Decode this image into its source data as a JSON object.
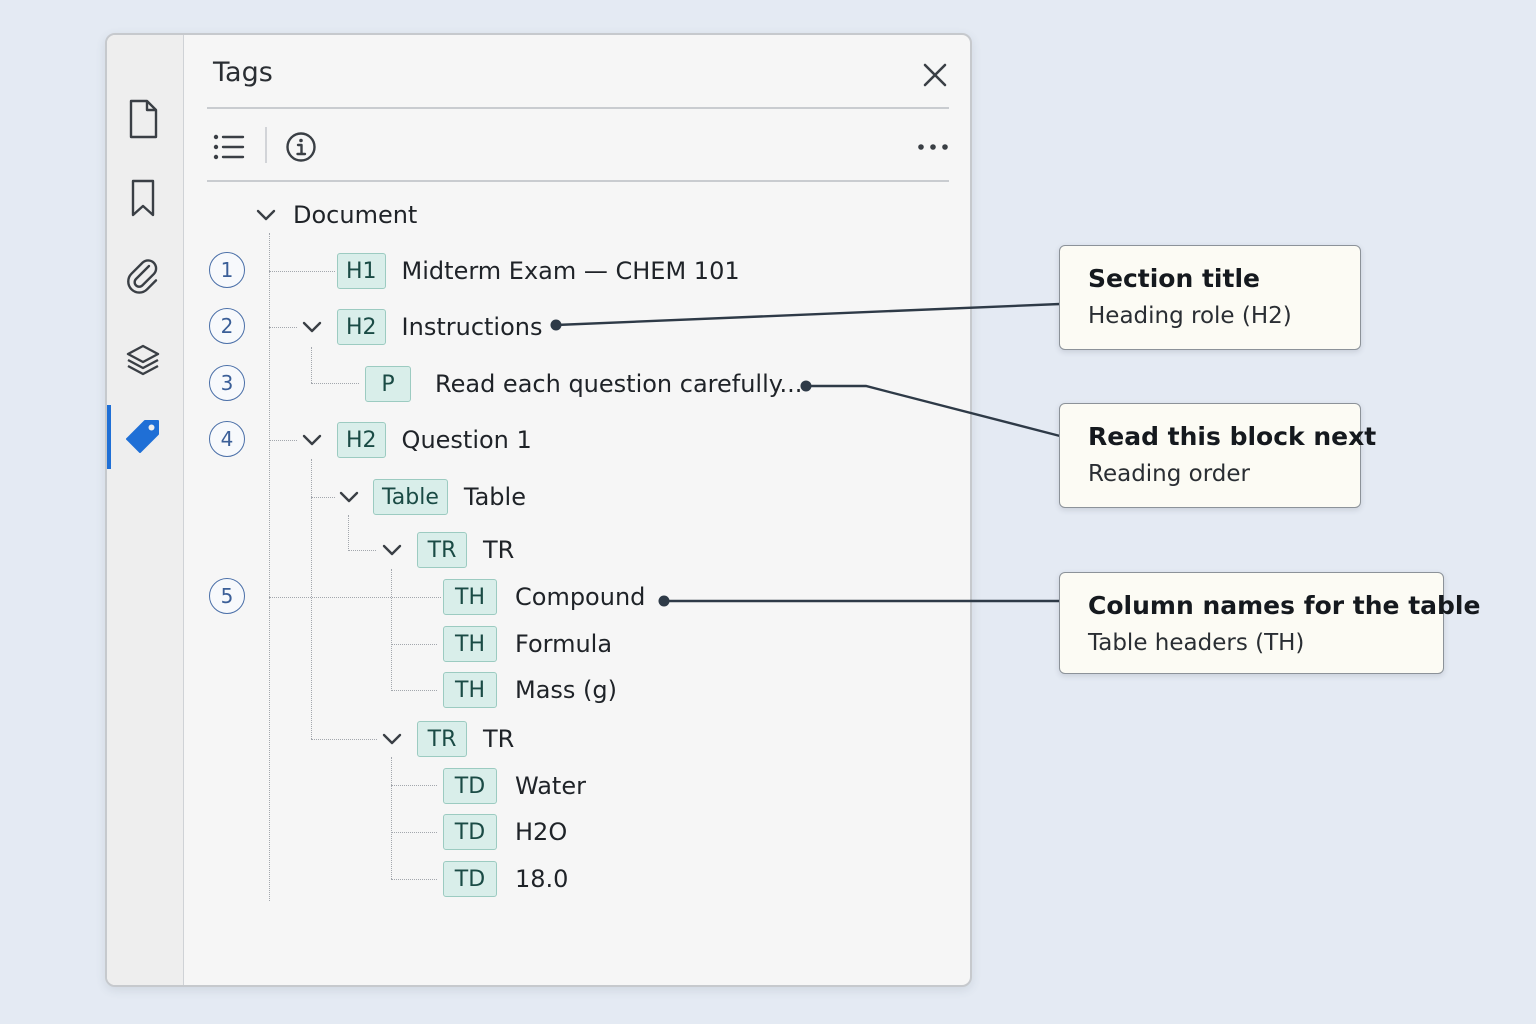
{
  "panel": {
    "title": "Tags",
    "rail_icons": [
      "page-icon",
      "bookmark-icon",
      "paperclip-icon",
      "layers-icon",
      "tag-icon"
    ],
    "active_rail": "tag-icon",
    "toolbar_icons": [
      "list-icon",
      "info-icon",
      "more-icon"
    ],
    "accent_color": "#1f6fd6",
    "tag_color": "#d9eeea"
  },
  "tree": {
    "root": "Document",
    "nodes": [
      {
        "tag": "H1",
        "label": "Midterm Exam — CHEM 101"
      },
      {
        "tag": "H2",
        "label": "Instructions"
      },
      {
        "tag": "P",
        "label": "Read each question carefully..."
      },
      {
        "tag": "H2",
        "label": "Question 1"
      },
      {
        "tag": "Table",
        "label": "Table"
      },
      {
        "tag": "TR",
        "label": "TR"
      },
      {
        "tag": "TH",
        "label": "Compound"
      },
      {
        "tag": "TH",
        "label": "Formula"
      },
      {
        "tag": "TH",
        "label": "Mass (g)"
      },
      {
        "tag": "TR",
        "label": "TR"
      },
      {
        "tag": "TD",
        "label": "Water"
      },
      {
        "tag": "TD",
        "label": "H2O"
      },
      {
        "tag": "TD",
        "label": "18.0"
      }
    ],
    "order_numbers": [
      "1",
      "2",
      "3",
      "4",
      "5"
    ]
  },
  "callouts": [
    {
      "heading": "Section title",
      "sub": "Heading role (H2)"
    },
    {
      "heading": "Read this block next",
      "sub": "Reading order"
    },
    {
      "heading": "Column names for the table",
      "sub": "Table headers (TH)"
    }
  ]
}
